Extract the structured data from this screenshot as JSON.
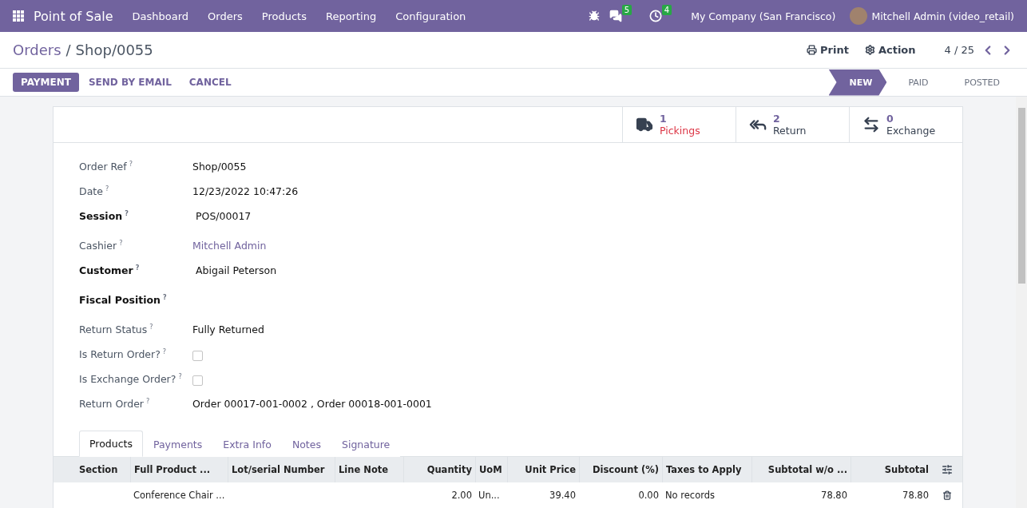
{
  "navbar": {
    "app_name": "Point of Sale",
    "menu": [
      "Dashboard",
      "Orders",
      "Products",
      "Reporting",
      "Configuration"
    ],
    "messages_badge": "5",
    "activities_badge": "4",
    "company": "My Company (San Francisco)",
    "user": "Mitchell Admin (video_retail)"
  },
  "breadcrumb": {
    "parent": "Orders",
    "separator": "/",
    "current": "Shop/0055"
  },
  "actions": {
    "print": "Print",
    "action": "Action",
    "pager": "4 / 25"
  },
  "buttons": [
    {
      "label": "PAYMENT",
      "primary": true
    },
    {
      "label": "SEND BY EMAIL",
      "primary": false
    },
    {
      "label": "CANCEL",
      "primary": false
    }
  ],
  "stages": [
    {
      "label": "NEW",
      "selected": true
    },
    {
      "label": "PAID",
      "selected": false
    },
    {
      "label": "POSTED",
      "selected": false
    }
  ],
  "stat_buttons": [
    {
      "kind": "truck",
      "count": "1",
      "label": "Pickings",
      "alert": true
    },
    {
      "kind": "return",
      "count": "2",
      "label": "Return",
      "alert": false
    },
    {
      "kind": "exchange",
      "count": "0",
      "label": "Exchange",
      "alert": false
    }
  ],
  "fields": [
    {
      "label": "Order Ref",
      "help": "?",
      "kind": "text",
      "bold": false,
      "value": "Shop/0055"
    },
    {
      "label": "Date",
      "help": "?",
      "kind": "text",
      "bold": false,
      "value": "12/23/2022 10:47:26"
    },
    {
      "label": "Session",
      "help": "?",
      "kind": "text",
      "bold": true,
      "value": "POS/00017"
    },
    {
      "label": "Cashier",
      "help": "?",
      "kind": "link",
      "bold": false,
      "value": "Mitchell Admin"
    },
    {
      "label": "Customer",
      "help": "?",
      "kind": "text",
      "bold": true,
      "value": "Abigail Peterson"
    },
    {
      "label": "Fiscal Position",
      "help": "?",
      "kind": "empty",
      "bold": true
    },
    {
      "label": "Return Status",
      "help": "?",
      "kind": "text",
      "bold": false,
      "value": "Fully Returned"
    },
    {
      "label": "Is Return Order?",
      "help": "?",
      "kind": "checkbox",
      "bold": false,
      "checked": false
    },
    {
      "label": "Is Exchange Order?",
      "help": "?",
      "kind": "checkbox",
      "bold": false,
      "checked": false
    },
    {
      "label": "Return Order",
      "help": "?",
      "kind": "text",
      "bold": false,
      "value": "Order 00017-001-0002 , Order 00018-001-0001"
    }
  ],
  "tabs": [
    {
      "label": "Products",
      "selected": true
    },
    {
      "label": "Payments",
      "selected": false
    },
    {
      "label": "Extra Info",
      "selected": false
    },
    {
      "label": "Notes",
      "selected": false
    },
    {
      "label": "Signature",
      "selected": false
    }
  ],
  "table": {
    "columns": [
      "Section",
      "Full Product ...",
      "Lot/serial Number",
      "Line Note",
      "Quantity",
      "UoM",
      "Unit Price",
      "Discount (%)",
      "Taxes to Apply",
      "Subtotal w/o ...",
      "Subtotal"
    ],
    "rows": [
      [
        "",
        "Conference Chair ...",
        "",
        "",
        "2.00",
        "Un...",
        "39.40",
        "0.00",
        "No records",
        "78.80",
        "78.80"
      ]
    ]
  }
}
